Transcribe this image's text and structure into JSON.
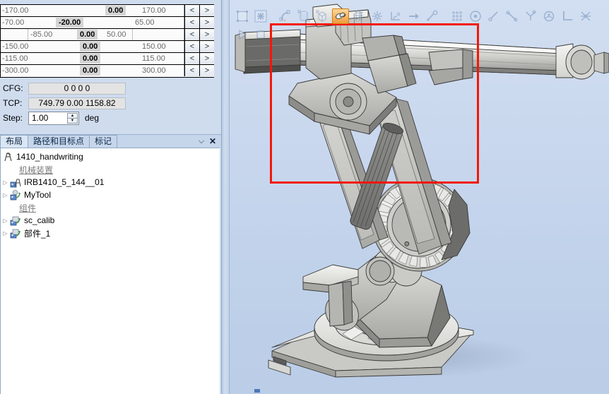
{
  "jog_panel": {
    "rows": [
      {
        "min": "-170.00",
        "value": "0.00",
        "max": "170.00",
        "sub_min": "",
        "sub_max": "",
        "dec_label": "<",
        "inc_label": ">",
        "value_pos": 148,
        "max_pos": 200,
        "indented": false
      },
      {
        "min": "-70.00",
        "value": "-20.00",
        "max": "65.00",
        "sub_min": "",
        "sub_max": "",
        "dec_label": "<",
        "inc_label": ">",
        "value_pos": 78,
        "max_pos": 190,
        "indented": false
      },
      {
        "min": "",
        "value": "0.00",
        "max": "",
        "sub_min": "-85.00",
        "sub_max": "50.00",
        "dec_label": "<",
        "inc_label": ">",
        "value_pos": 108,
        "max_pos": 0,
        "indented": true
      },
      {
        "min": "-150.00",
        "value": "0.00",
        "max": "150.00",
        "sub_min": "",
        "sub_max": "",
        "dec_label": "<",
        "inc_label": ">",
        "value_pos": 112,
        "max_pos": 200,
        "indented": false
      },
      {
        "min": "-115.00",
        "value": "0.00",
        "max": "115.00",
        "sub_min": "",
        "sub_max": "",
        "dec_label": "<",
        "inc_label": ">",
        "value_pos": 112,
        "max_pos": 200,
        "indented": false
      },
      {
        "min": "-300.00",
        "value": "0.00",
        "max": "300.00",
        "sub_min": "",
        "sub_max": "",
        "dec_label": "<",
        "inc_label": ">",
        "value_pos": 112,
        "max_pos": 200,
        "indented": false
      }
    ]
  },
  "fields": {
    "cfg_label": "CFG:",
    "cfg_value": "0 0 0 0",
    "tcp_label": "TCP:",
    "tcp_value": "749.79 0.00 1158.82",
    "step_label": "Step:",
    "step_value": "1.00",
    "step_unit": "deg",
    "spin_up": "▲",
    "spin_down": "▼"
  },
  "tabs": {
    "items": [
      {
        "label": "布局",
        "active": true
      },
      {
        "label": "路径和目标点",
        "active": false
      },
      {
        "label": "标记",
        "active": false
      }
    ],
    "menu_glyph": "⌵",
    "close_glyph": "✕"
  },
  "tree": {
    "nodes": [
      {
        "type": "station",
        "label": "1410_handwriting",
        "indent": 0,
        "expander": "",
        "icon": "station-icon"
      },
      {
        "type": "group",
        "label": "机械装置",
        "indent": 1,
        "expander": "",
        "icon": ""
      },
      {
        "type": "item",
        "label": "IRB1410_5_144__01",
        "indent": 1,
        "expander": "▷",
        "icon": "robot-icon"
      },
      {
        "type": "item",
        "label": "MyTool",
        "indent": 1,
        "expander": "▷",
        "icon": "tool-icon"
      },
      {
        "type": "group",
        "label": "组件",
        "indent": 1,
        "expander": "",
        "icon": ""
      },
      {
        "type": "item",
        "label": "sc_calib",
        "indent": 1,
        "expander": "▷",
        "icon": "part-icon"
      },
      {
        "type": "item",
        "label": "部件_1",
        "indent": 1,
        "expander": "▷",
        "icon": "part-icon"
      }
    ]
  },
  "viewport_toolbar": {
    "row1": [
      {
        "name": "select-surface-icon",
        "state": "disabled"
      },
      {
        "name": "select-component-icon",
        "state": "disabled"
      },
      {
        "name": "separator",
        "state": "sep"
      },
      {
        "name": "snap-curve-icon",
        "state": "disabled"
      },
      {
        "name": "snap-object-icon",
        "state": "disabled"
      },
      {
        "name": "snap-box-icon",
        "state": "disabled"
      },
      {
        "name": "snap-surface-icon",
        "state": "active"
      },
      {
        "name": "snap-grid-icon",
        "state": "disabled"
      },
      {
        "name": "snap-mesh-icon",
        "state": "disabled"
      },
      {
        "name": "snap-angle-icon",
        "state": "disabled"
      },
      {
        "name": "snap-arrow-icon",
        "state": "disabled"
      },
      {
        "name": "snap-node-icon",
        "state": "disabled"
      },
      {
        "name": "separator",
        "state": "sep"
      },
      {
        "name": "snap-pointcloud-icon",
        "state": "disabled"
      },
      {
        "name": "snap-center-icon",
        "state": "disabled"
      },
      {
        "name": "snap-endpoint-icon",
        "state": "disabled"
      },
      {
        "name": "snap-midpoint-icon",
        "state": "disabled"
      },
      {
        "name": "snap-intersection-icon",
        "state": "disabled"
      },
      {
        "name": "snap-circle-center-icon",
        "state": "disabled"
      },
      {
        "name": "snap-coordinate-icon",
        "state": "disabled"
      },
      {
        "name": "snap-tangent-icon",
        "state": "disabled"
      }
    ],
    "row2": [
      {
        "name": "play-icon",
        "state": "disabled"
      },
      {
        "name": "stop-icon",
        "state": "disabled"
      }
    ]
  },
  "viewport": {
    "selection_rect_color": "#f41709",
    "background_top": "#d4e0f2",
    "background_bottom": "#b8c9e2",
    "robot_label": "IRB1410 industrial robot 3D view"
  }
}
